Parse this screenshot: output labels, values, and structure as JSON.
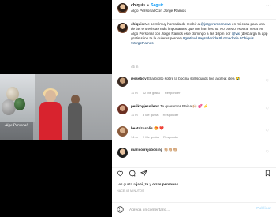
{
  "header": {
    "username": "chiquis",
    "dot": "•",
    "follow_label": "Seguir",
    "subtitle": "Algo Personal Con Jorge Ramos",
    "more": "···"
  },
  "media": {
    "watermark": "Algo Personal"
  },
  "caption": {
    "username": "chiquis",
    "text_1": " Me sentí muy honrada de recibir a ",
    "mention_1": "@jorgeramosnews",
    "text_2": " en mi casa para una de las entrevistas más importantes que me han hecho. No puedo esperar verla en Algo Personal con Jorge Ramos este domingo a las 10pm por ",
    "mention_2": "@vix",
    "text_3": " (descarga la app gratis si no te la quieres perder) ",
    "tags": "#gratitud #agradecida #luzmadoria #Chiquis #JorgeRamos",
    "time": "45 m"
  },
  "comments": [
    {
      "username": "jesseboy",
      "text": " El arbolito sobre la bocina still sounds like a great idea 😭",
      "time": "11 m",
      "likes": "12 Me gusta",
      "reply": "Responder"
    },
    {
      "username": "perikoyjessileon",
      "text": " Te queremos Reina 🙌🏼 💕 ⚡",
      "time": "11 m",
      "likes": "8 Me gusta",
      "reply": "Responder"
    },
    {
      "username": "beatrizasolis",
      "text": " 😍 ❤️",
      "time": "14 m",
      "likes": "3 Me gusta",
      "reply": "Responder"
    },
    {
      "username": "maricorrejobosing",
      "text": " 👏🏼👏🏼👏🏼",
      "time": "",
      "likes": "",
      "reply": ""
    }
  ],
  "actions": {
    "like_icon": "heart-icon",
    "comment_icon": "comment-icon",
    "share_icon": "share-icon",
    "save_icon": "bookmark-icon"
  },
  "likes": {
    "prefix": "Les gusta a ",
    "user": "jani_za",
    "suffix": " y ",
    "others": "otras personas"
  },
  "post_time": "HACE 45 MINUTOS",
  "add_comment": {
    "placeholder": "Agrega un comentario...",
    "publish_label": "Publicar"
  },
  "colors": {
    "accent": "#0095f6",
    "link": "#00376b",
    "muted": "#8e8e8e",
    "publish_disabled": "#b2dffc",
    "dress": "#d8232e"
  }
}
